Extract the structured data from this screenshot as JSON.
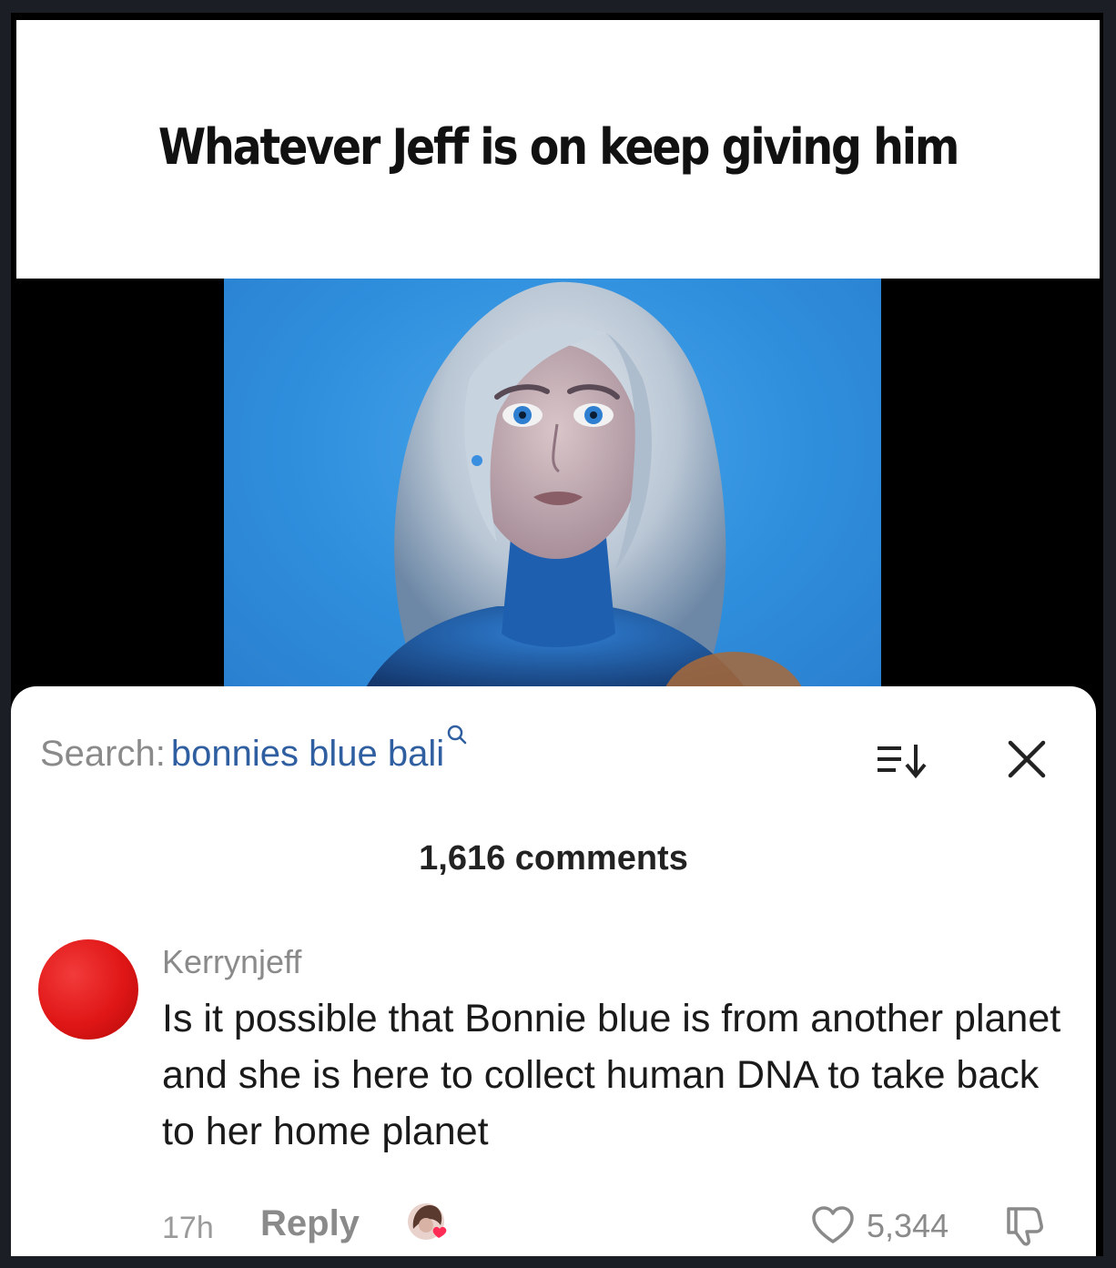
{
  "caption": "Whatever Jeff is on keep giving him",
  "search": {
    "label": "Search:",
    "query": "bonnies blue bali"
  },
  "comments": {
    "count_label": "1,616 comments"
  },
  "comment": {
    "username": "Kerrynjeff",
    "text": "Is it possible that Bonnie blue is from another planet and she is here to collect human DNA to take back to her home planet",
    "time": "17h",
    "reply_label": "Reply",
    "like_count": "5,344"
  },
  "icons": {
    "search": "search-icon",
    "sort": "sort-icon",
    "close": "close-icon",
    "like": "heart-icon",
    "dislike": "thumbs-down-icon",
    "creator_liked": "creator-liked-badge"
  },
  "colors": {
    "query": "#2f5fa0",
    "avatar": "#e01616",
    "photo_background": "#2f8fdd"
  }
}
